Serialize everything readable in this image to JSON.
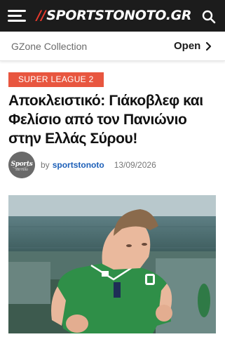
{
  "header": {
    "logo_slashes": "//",
    "logo_text": "SPORTSTONOTO.GR",
    "menu_icon": "hamburger-menu-icon",
    "search_icon": "search-icon",
    "background": "#1c1c1c",
    "accent": "#e8392c"
  },
  "promo": {
    "label": "GZone Collection",
    "action": "Open",
    "action_icon": "chevron-right-icon"
  },
  "article": {
    "category": "SUPER LEAGUE 2",
    "category_color": "#e8563f",
    "title": "Αποκλειστικό: Γιάκοβλεφ και Φελίσιο από τον Πανιώνιο στην Ελλάς Σύρου!",
    "avatar_text": "Sports",
    "avatar_subtext": "sto noto",
    "by_label": "by",
    "author": "sportstonoto",
    "author_color": "#1c5fb8",
    "date": "13/09/2026"
  }
}
